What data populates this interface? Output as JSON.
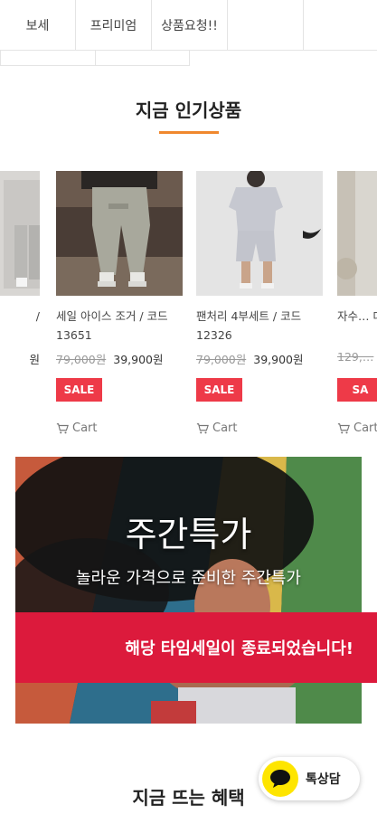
{
  "nav": {
    "tabs": [
      {
        "label": "보세"
      },
      {
        "label": "프리미엄"
      },
      {
        "label": "상품요청!!"
      },
      {
        "label": ""
      }
    ]
  },
  "popular": {
    "title": "지금 인기상품",
    "accent_color": "#f0882e",
    "products": [
      {
        "name_partial": "/",
        "price_partial": "원"
      },
      {
        "name": "세일 아이스 조거 / 코드13651",
        "old_price": "79,000원",
        "price": "39,900원",
        "badge": "SALE",
        "cart": "Cart"
      },
      {
        "name": "팬처리 4부세트 / 코드12326",
        "old_price": "79,000원",
        "price": "39,900원",
        "badge": "SALE",
        "cart": "Cart"
      },
      {
        "name_partial": "자수… 데일…",
        "old_price_partial": "129,…",
        "badge_partial": "SA",
        "cart": "Cart"
      }
    ]
  },
  "banner": {
    "title": "주간특가",
    "subtitle": "놀라운 가격으로 준비한 주간특가",
    "timesale_notice": "해당 타임세일이 종료되었습니다!",
    "timesale_color": "#dc1a3c"
  },
  "benefits": {
    "title": "지금 뜨는 혜택"
  },
  "kakao": {
    "label": "톡상담",
    "color": "#fee500"
  },
  "icons": [
    "cart-icon",
    "kakao-chat-icon"
  ]
}
